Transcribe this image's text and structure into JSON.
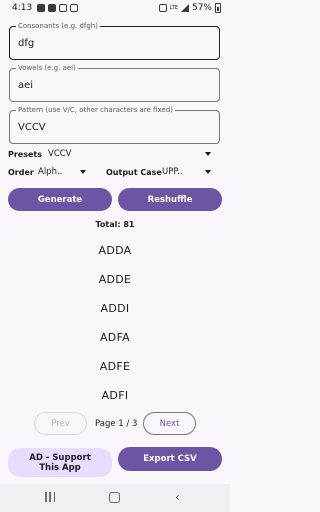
{
  "status_bar": {
    "time": "4:13",
    "network": "LTE",
    "battery": "57%"
  },
  "fields": {
    "consonants": {
      "label": "Consonants (e.g. dfgh)",
      "value": "dfg"
    },
    "vowels": {
      "label": "Vowels (e.g. aei)",
      "value": "aei"
    },
    "pattern": {
      "label": "Pattern (use V/C, other characters are fixed)",
      "value": "VCCV"
    }
  },
  "presets": {
    "label": "Presets",
    "value": "VCCV"
  },
  "order": {
    "label": "Order",
    "value": "Alph.."
  },
  "output_case": {
    "label": "Output Case",
    "value": "UPP.."
  },
  "buttons": {
    "generate": "Generate",
    "reshuffle": "Reshuffle",
    "prev": "Prev",
    "next": "Next",
    "support": "AD - Support This App",
    "export": "Export CSV"
  },
  "total": "Total: 81",
  "results": [
    "ADDA",
    "ADDE",
    "ADDI",
    "ADFA",
    "ADFE",
    "ADFI"
  ],
  "page_info": "Page 1 / 3",
  "colors": {
    "primary": "#6d55a6",
    "tonal": "#e9ddff",
    "background": "#fbf6fb"
  }
}
